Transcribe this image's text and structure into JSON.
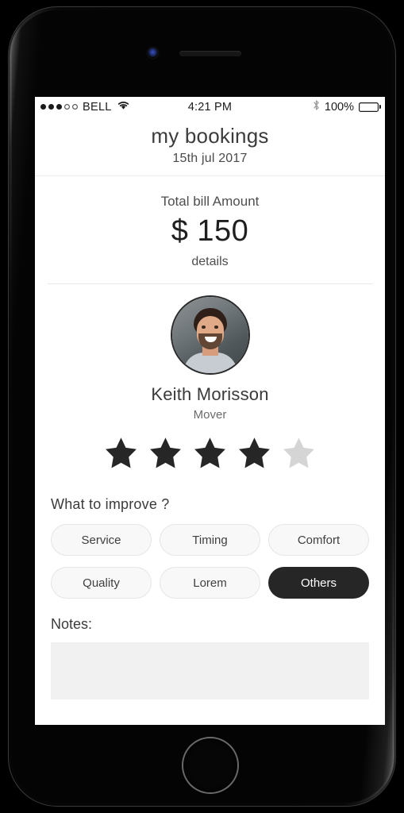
{
  "status_bar": {
    "signal_dots_filled": 3,
    "signal_dots_empty": 2,
    "carrier": "BELL",
    "wifi_icon": "wifi-icon",
    "time": "4:21 PM",
    "bluetooth_icon": "bluetooth-icon",
    "battery_percent": "100%",
    "battery_icon": "battery-full-icon"
  },
  "header": {
    "title": "my bookings",
    "subtitle": "15th jul 2017"
  },
  "bill": {
    "label": "Total bill Amount",
    "amount": "$ 150",
    "details_link": "details"
  },
  "profile": {
    "avatar_icon": "user-avatar-photo",
    "name": "Keith Morisson",
    "role": "Mover"
  },
  "rating": {
    "value": 4,
    "max": 5,
    "filled_color": "#262626",
    "empty_color": "#d5d5d5"
  },
  "improve": {
    "title": "What to improve ?",
    "chips": [
      {
        "label": "Service",
        "selected": false
      },
      {
        "label": "Timing",
        "selected": false
      },
      {
        "label": "Comfort",
        "selected": false
      },
      {
        "label": "Quality",
        "selected": false
      },
      {
        "label": "Lorem",
        "selected": false
      },
      {
        "label": "Others",
        "selected": true
      }
    ]
  },
  "notes": {
    "label": "Notes:",
    "value": "",
    "placeholder": ""
  },
  "device": {
    "front_camera_icon": "front-camera-icon",
    "earpiece_icon": "earpiece-speaker-icon",
    "home_button_icon": "home-button-icon"
  }
}
